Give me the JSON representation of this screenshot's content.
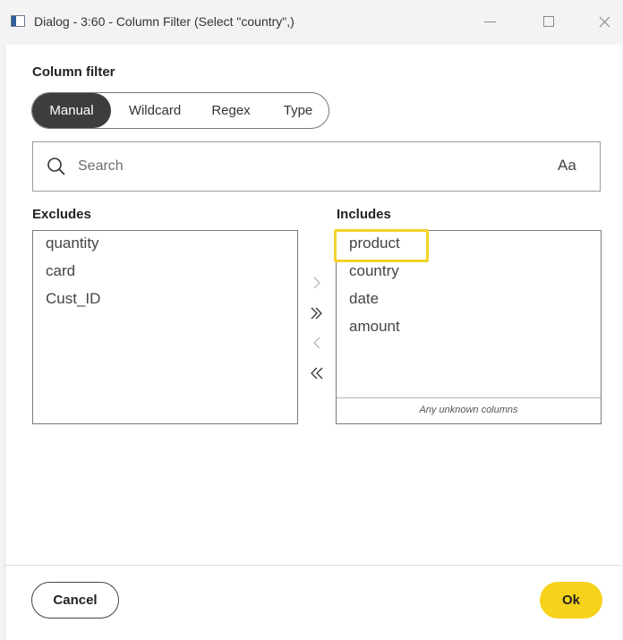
{
  "window": {
    "title": "Dialog - 3:60 - Column Filter (Select \"country\",)",
    "minimize_icon": "minimize-icon",
    "maximize_icon": "maximize-icon",
    "close_icon": "close-icon"
  },
  "dialog": {
    "section_title": "Column filter",
    "modes": [
      {
        "label": "Manual",
        "active": true
      },
      {
        "label": "Wildcard",
        "active": false
      },
      {
        "label": "Regex",
        "active": false
      },
      {
        "label": "Type",
        "active": false
      }
    ],
    "search": {
      "placeholder": "Search",
      "value": "",
      "icon": "search-icon",
      "case_toggle_label": "Aa"
    },
    "excludes": {
      "title": "Excludes",
      "items": [
        "quantity",
        "card",
        "Cust_ID"
      ]
    },
    "includes": {
      "title": "Includes",
      "items": [
        "product",
        "country",
        "date",
        "amount"
      ],
      "highlighted_item": "product",
      "unknown_columns_label": "Any unknown columns"
    },
    "transfer_buttons": [
      "move-right-icon",
      "move-all-right-icon",
      "move-left-icon",
      "move-all-left-icon"
    ]
  },
  "footer": {
    "cancel_label": "Cancel",
    "ok_label": "Ok"
  },
  "colors": {
    "accent": "#f7d21b",
    "active_segment": "#3d3d3d",
    "highlight_border": "#f5d32c"
  }
}
